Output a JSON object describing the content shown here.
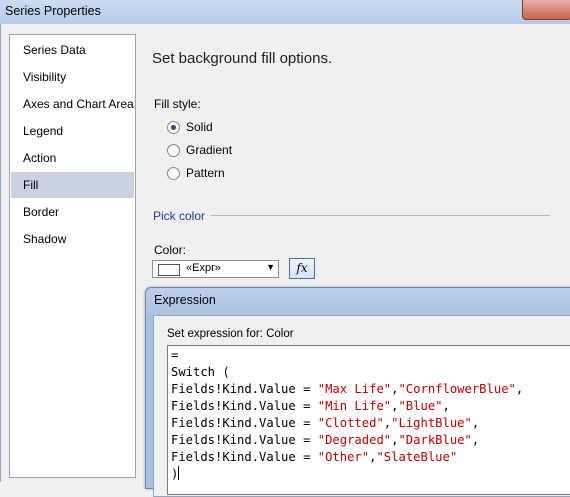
{
  "window": {
    "title": "Series Properties"
  },
  "sidebar": {
    "items": [
      {
        "label": "Series Data",
        "selected": false
      },
      {
        "label": "Visibility",
        "selected": false
      },
      {
        "label": "Axes and Chart Area",
        "selected": false
      },
      {
        "label": "Legend",
        "selected": false
      },
      {
        "label": "Action",
        "selected": false
      },
      {
        "label": "Fill",
        "selected": true
      },
      {
        "label": "Border",
        "selected": false
      },
      {
        "label": "Shadow",
        "selected": false
      }
    ]
  },
  "main": {
    "heading": "Set background fill options.",
    "fill_style_label": "Fill style:",
    "fill_options": [
      {
        "label": "Solid",
        "checked": true
      },
      {
        "label": "Gradient",
        "checked": false
      },
      {
        "label": "Pattern",
        "checked": false
      }
    ],
    "pick_color_label": "Pick color",
    "color_label": "Color:",
    "color_value": "«Expr»",
    "fx_label": "fx"
  },
  "expression_dialog": {
    "title": "Expression",
    "set_for_label": "Set expression for: Color",
    "code_lines": [
      {
        "segments": [
          {
            "t": "="
          }
        ]
      },
      {
        "segments": [
          {
            "t": "Switch ("
          }
        ]
      },
      {
        "segments": [
          {
            "t": "Fields!Kind.Value = "
          },
          {
            "t": "\"Max Life\"",
            "s": true
          },
          {
            "t": ","
          },
          {
            "t": "\"CornflowerBlue\"",
            "s": true
          },
          {
            "t": ","
          }
        ]
      },
      {
        "segments": [
          {
            "t": "Fields!Kind.Value = "
          },
          {
            "t": "\"Min Life\"",
            "s": true
          },
          {
            "t": ","
          },
          {
            "t": "\"Blue\"",
            "s": true
          },
          {
            "t": ","
          }
        ]
      },
      {
        "segments": [
          {
            "t": "Fields!Kind.Value = "
          },
          {
            "t": "\"Clotted\"",
            "s": true
          },
          {
            "t": ","
          },
          {
            "t": "\"LightBlue\"",
            "s": true
          },
          {
            "t": ","
          }
        ]
      },
      {
        "segments": [
          {
            "t": "Fields!Kind.Value = "
          },
          {
            "t": "\"Degraded\"",
            "s": true
          },
          {
            "t": ","
          },
          {
            "t": "\"DarkBlue\"",
            "s": true
          },
          {
            "t": ","
          }
        ]
      },
      {
        "segments": [
          {
            "t": "Fields!Kind.Value = "
          },
          {
            "t": "\"Other\"",
            "s": true
          },
          {
            "t": ","
          },
          {
            "t": "\"SlateBlue\"",
            "s": true
          }
        ]
      },
      {
        "segments": [
          {
            "t": ")"
          }
        ]
      }
    ]
  },
  "colors": {
    "string_literal": "#c00000",
    "selected_item": "#c8d3df",
    "section_label": "#1e3c8c"
  }
}
